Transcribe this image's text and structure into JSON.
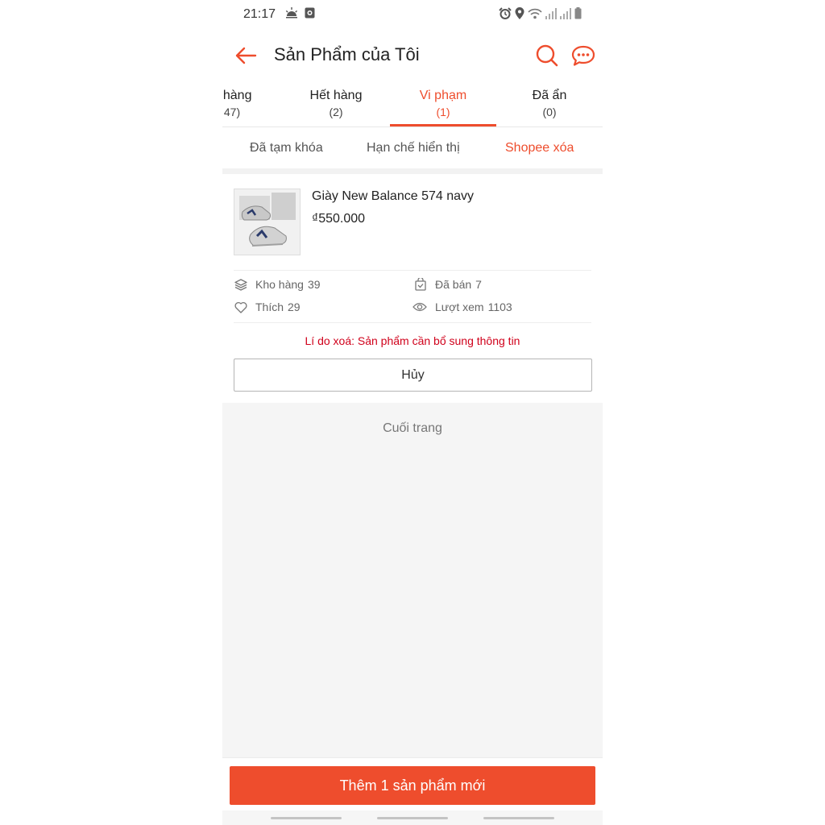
{
  "status_bar": {
    "time": "21:17",
    "left_icons": [
      "weather-icon",
      "notification-icon"
    ],
    "right_icons": [
      "alarm-icon",
      "location-icon",
      "wifi-icon",
      "signal-icon",
      "signal-icon",
      "battery-icon"
    ]
  },
  "header": {
    "title": "Sản Phẩm của Tôi",
    "back_icon": "arrow-left-icon",
    "search_icon": "search-icon",
    "chat_icon": "chat-icon"
  },
  "tabs": [
    {
      "label": "n hàng",
      "count": "47)",
      "active": false
    },
    {
      "label": "Hết hàng",
      "count": "(2)",
      "active": false
    },
    {
      "label": "Vi phạm",
      "count": "(1)",
      "active": true
    },
    {
      "label": "Đã ẩn",
      "count": "(0)",
      "active": false
    }
  ],
  "subtabs": [
    {
      "label": "Đã tạm khóa",
      "active": false
    },
    {
      "label": "Hạn chế hiển thị",
      "active": false
    },
    {
      "label": "Shopee xóa",
      "active": true
    }
  ],
  "product": {
    "name": "Giày New Balance 574 navy",
    "price": "₫550.000",
    "stats": {
      "stock_label": "Kho hàng",
      "stock_value": "39",
      "sold_label": "Đã bán",
      "sold_value": "7",
      "likes_label": "Thích",
      "likes_value": "29",
      "views_label": "Lượt xem",
      "views_value": "1103"
    },
    "reason": "Lí do xoá: Sản phẩm cần bổ sung thông tin",
    "cancel_label": "Hủy"
  },
  "end_of_page": "Cuối trang",
  "add_button_label": "Thêm 1 sản phẩm mới",
  "colors": {
    "accent": "#ee4d2d",
    "reason_text": "#d0011b",
    "background_gray": "#f5f5f5"
  }
}
